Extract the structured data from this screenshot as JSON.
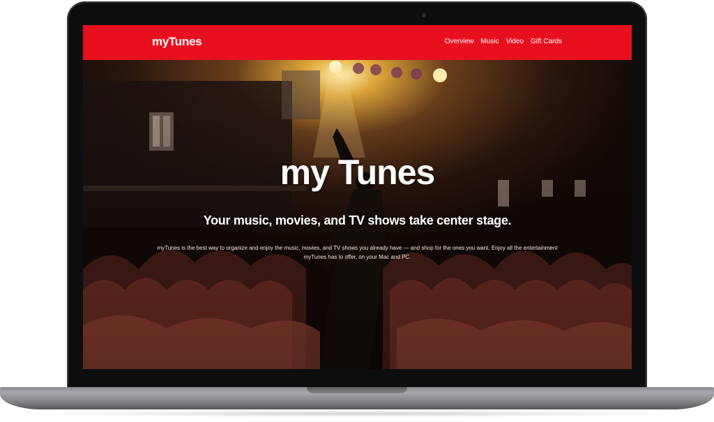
{
  "navbar": {
    "brand": "myTunes",
    "links": [
      "Overview",
      "Music",
      "Video",
      "Gift Cards"
    ],
    "background_color": "#e8101f"
  },
  "hero": {
    "title": "my Tunes",
    "subtitle": "Your music, movies, and TV shows take center stage.",
    "description": "myTunes is the best way to organize and enjoy the music, movies, and TV shows you already have — and shop for the ones you want. Enjoy all the entertainment myTunes has to offer, on your Mac and PC.",
    "image": "concert-crowd-performer-photo"
  },
  "device": "laptop-mockup"
}
